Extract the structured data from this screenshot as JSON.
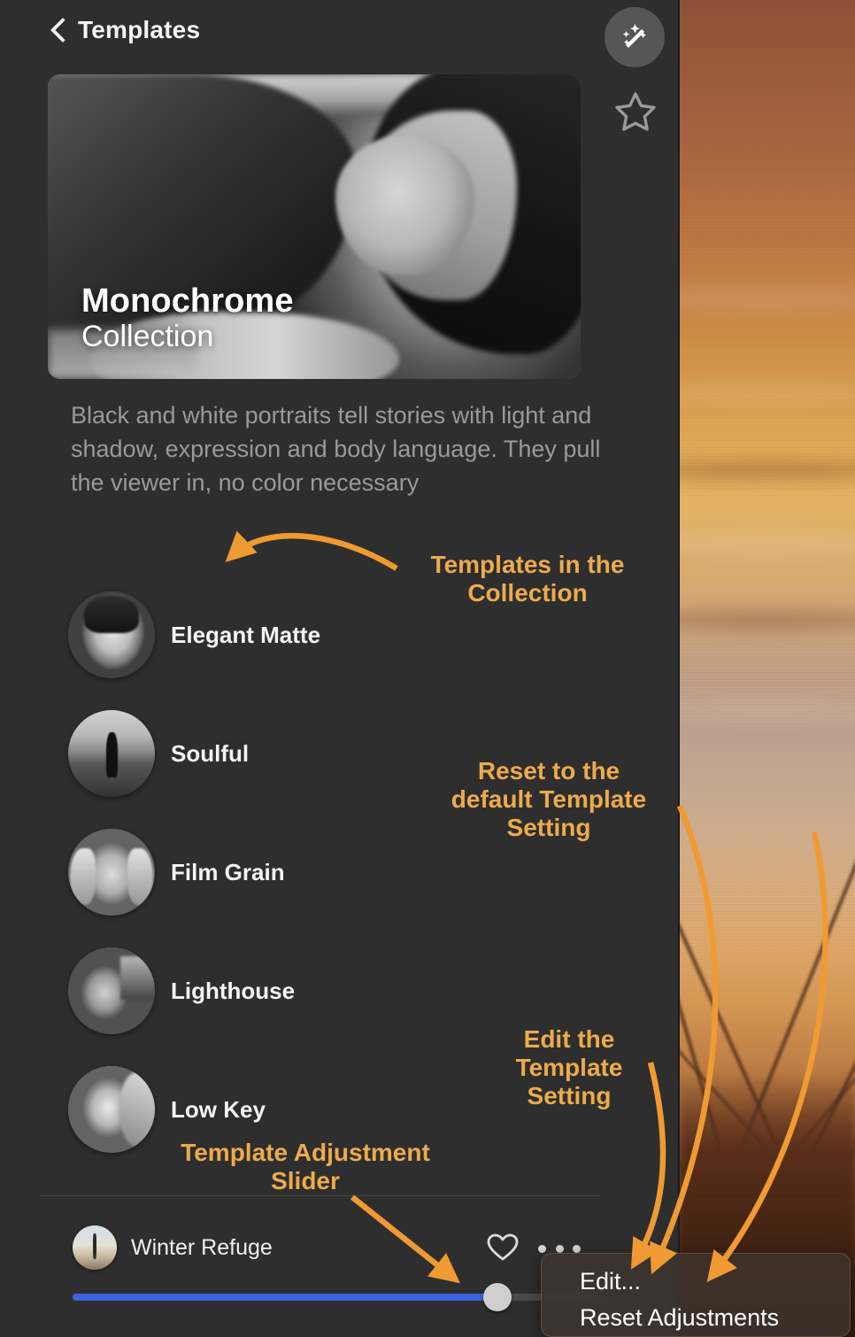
{
  "header": {
    "back_label": "Templates",
    "back_icon": "chevron-left-icon",
    "magic_icon": "magic-wand-sparkles-icon",
    "star_icon": "star-outline-icon"
  },
  "hero": {
    "title": "Monochrome",
    "subtitle": "Collection",
    "image_alt": "black-and-white-portrait-woman-lying-down"
  },
  "description": "Black and white portraits tell stories with light and shadow, expression and body language. They pull the viewer in, no color necessary",
  "templates": [
    {
      "name": "Elegant Matte",
      "thumb": "portrait-thumb-1"
    },
    {
      "name": "Soulful",
      "thumb": "portrait-thumb-2"
    },
    {
      "name": "Film Grain",
      "thumb": "portrait-thumb-3"
    },
    {
      "name": "Lighthouse",
      "thumb": "portrait-thumb-4"
    },
    {
      "name": "Low Key",
      "thumb": "portrait-thumb-5"
    }
  ],
  "bottom_bar": {
    "preset_name": "Winter Refuge",
    "thumb": "winter-refuge-thumb",
    "heart_icon": "heart-outline-icon",
    "more_icon": "ellipsis-icon",
    "slider": {
      "value_percent": 80,
      "fill_color": "#3b63e0",
      "track_color": "#4b4b4b",
      "thumb_color": "#cfcfcf"
    }
  },
  "context_menu": {
    "items": [
      "Edit...",
      "Reset Adjustments"
    ]
  },
  "annotations": {
    "color": "#ecab4c",
    "items": [
      {
        "id": "anno-templates",
        "text": "Templates in the\nCollection"
      },
      {
        "id": "anno-reset",
        "text": "Reset to the\ndefault Template\nSetting"
      },
      {
        "id": "anno-edit",
        "text": "Edit the\nTemplate\nSetting"
      },
      {
        "id": "anno-slider",
        "text": "Template Adjustment\nSlider"
      }
    ]
  },
  "background_photo": {
    "alt": "blurred-sunset-over-grass-field"
  }
}
